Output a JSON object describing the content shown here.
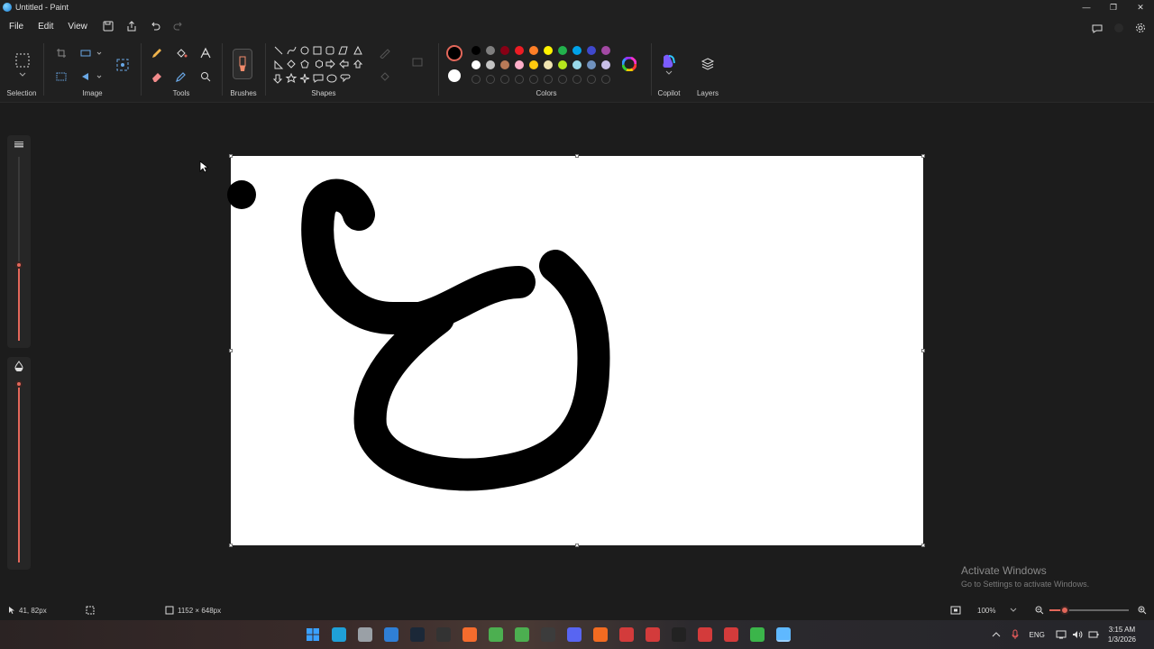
{
  "window": {
    "title": "Untitled - Paint",
    "controls": [
      "minimize",
      "restore",
      "close"
    ]
  },
  "menu": {
    "items": [
      "File",
      "Edit",
      "View"
    ],
    "quick_access_icons": [
      "save-icon",
      "share-icon",
      "undo-icon",
      "redo-icon"
    ],
    "right_icons": [
      "feedback-icon",
      "account-icon",
      "settings-icon"
    ]
  },
  "ribbon": {
    "groups": {
      "selection": "Selection",
      "image": "Image",
      "tools": "Tools",
      "brushes": "Brushes",
      "shapes": "Shapes",
      "colors": "Colors",
      "copilot": "Copilot",
      "layers": "Layers"
    },
    "primary_color": "#000000",
    "secondary_color": "#ffffff",
    "palette_row1": [
      "#000000",
      "#7f7f7f",
      "#880015",
      "#ed1c24",
      "#ff7f27",
      "#fff200",
      "#22b14c",
      "#00a2e8",
      "#3f48cc",
      "#a349a4"
    ],
    "palette_row2": [
      "#ffffff",
      "#c3c3c3",
      "#b97a57",
      "#ffaec9",
      "#ffc90e",
      "#efe4b0",
      "#b5e61d",
      "#99d9ea",
      "#7092be",
      "#c8bfe7"
    ],
    "accent_color": "#e3675a"
  },
  "sliders": {
    "size_level": 0.62,
    "opacity_level": 1.0
  },
  "watermark": {
    "title": "Activate Windows",
    "subtitle": "Go to Settings to activate Windows."
  },
  "status": {
    "cursor_position": "41, 82px",
    "canvas_size": "1152 × 648px",
    "zoom": "100%"
  },
  "taskbar": {
    "language": "ENG",
    "time": "3:15 AM",
    "date": "1/3/2026",
    "icons": [
      "start-icon",
      "edge-icon",
      "settings-icon",
      "store-icon",
      "steam-icon",
      "epic-icon",
      "origin-icon",
      "chrome-icon",
      "chrome-icon",
      "obs-icon",
      "discord-icon",
      "adobe-icon",
      "app-icon",
      "app-icon",
      "capcut-icon",
      "app-icon",
      "app-icon",
      "xbox-icon",
      "paint-icon"
    ]
  }
}
